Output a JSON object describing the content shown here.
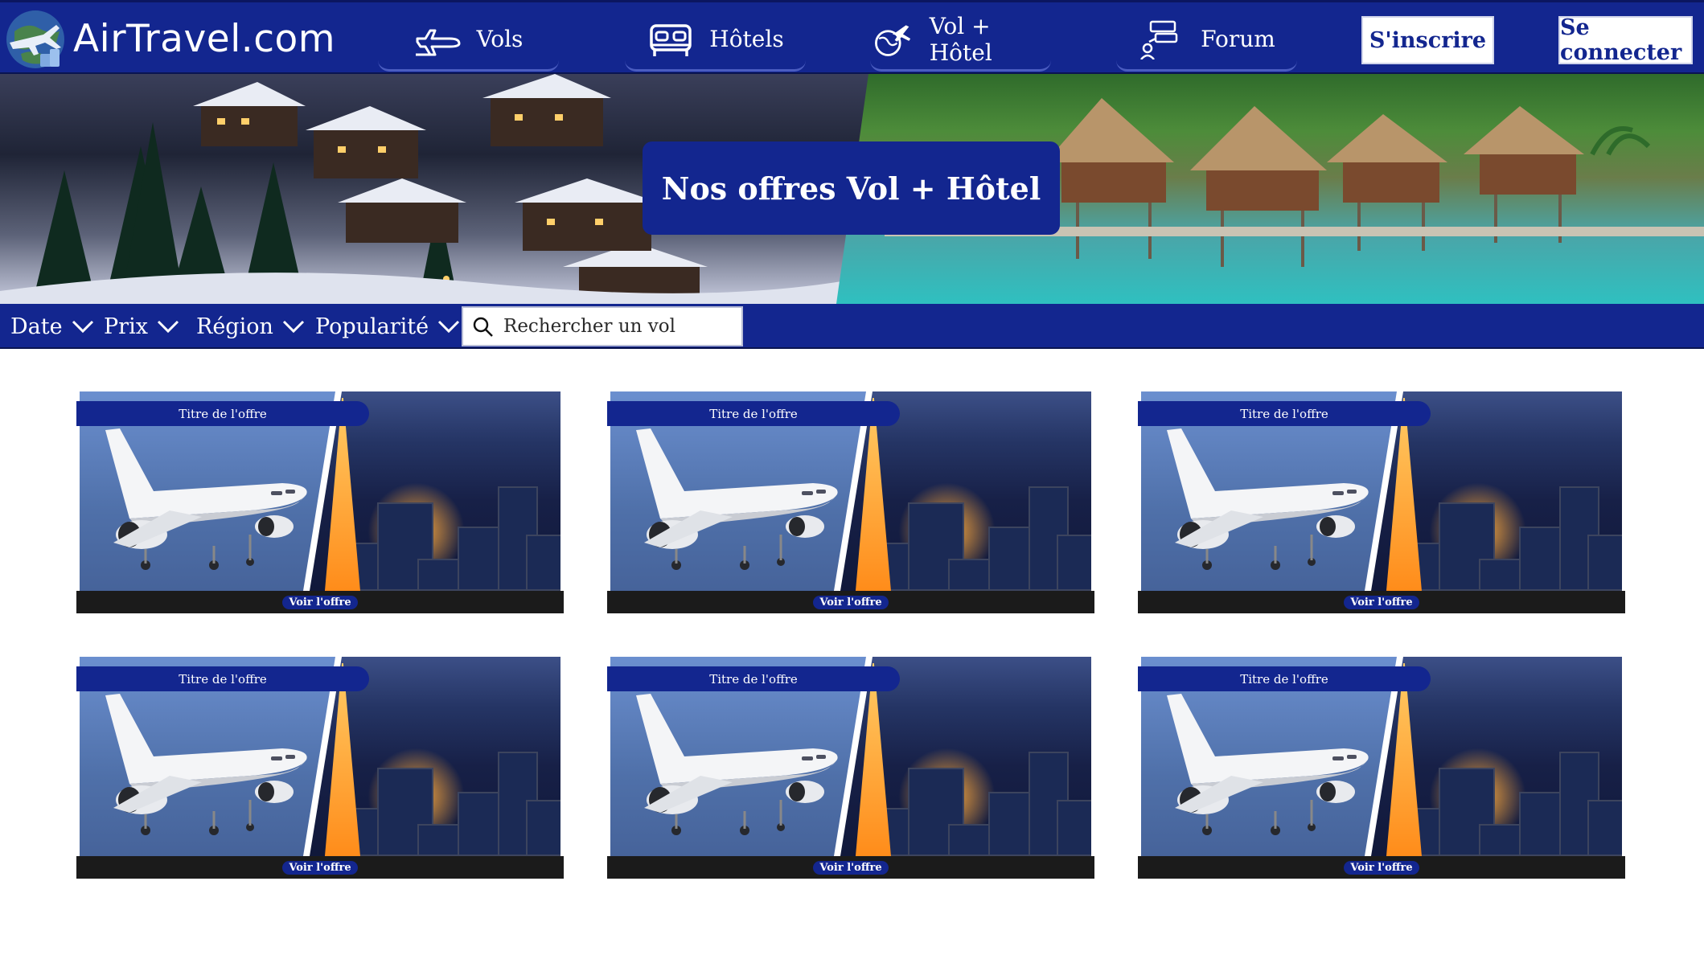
{
  "header": {
    "brand": "AirTravel.com",
    "nav": [
      {
        "label": "Vols",
        "icon": "plane-icon"
      },
      {
        "label": "Hôtels",
        "icon": "bed-icon"
      },
      {
        "label": "Vol + Hôtel",
        "icon": "globe-plane-icon"
      },
      {
        "label": "Forum",
        "icon": "forum-icon"
      }
    ],
    "signup_label": "S'inscrire",
    "login_label": "Se connecter"
  },
  "hero": {
    "title": "Nos offres Vol + Hôtel"
  },
  "filters": {
    "items": [
      "Date",
      "Prix",
      "Région",
      "Popularité"
    ],
    "search_placeholder": "Rechercher un vol"
  },
  "offers": [
    {
      "title": "Titre de l'offre",
      "cta": "Voir l'offre"
    },
    {
      "title": "Titre de l'offre",
      "cta": "Voir l'offre"
    },
    {
      "title": "Titre de l'offre",
      "cta": "Voir l'offre"
    },
    {
      "title": "Titre de l'offre",
      "cta": "Voir l'offre"
    },
    {
      "title": "Titre de l'offre",
      "cta": "Voir l'offre"
    },
    {
      "title": "Titre de l'offre",
      "cta": "Voir l'offre"
    }
  ],
  "colors": {
    "brand_blue": "#13268f",
    "card_bar": "#1b1b1b",
    "background": "#ffffff"
  }
}
